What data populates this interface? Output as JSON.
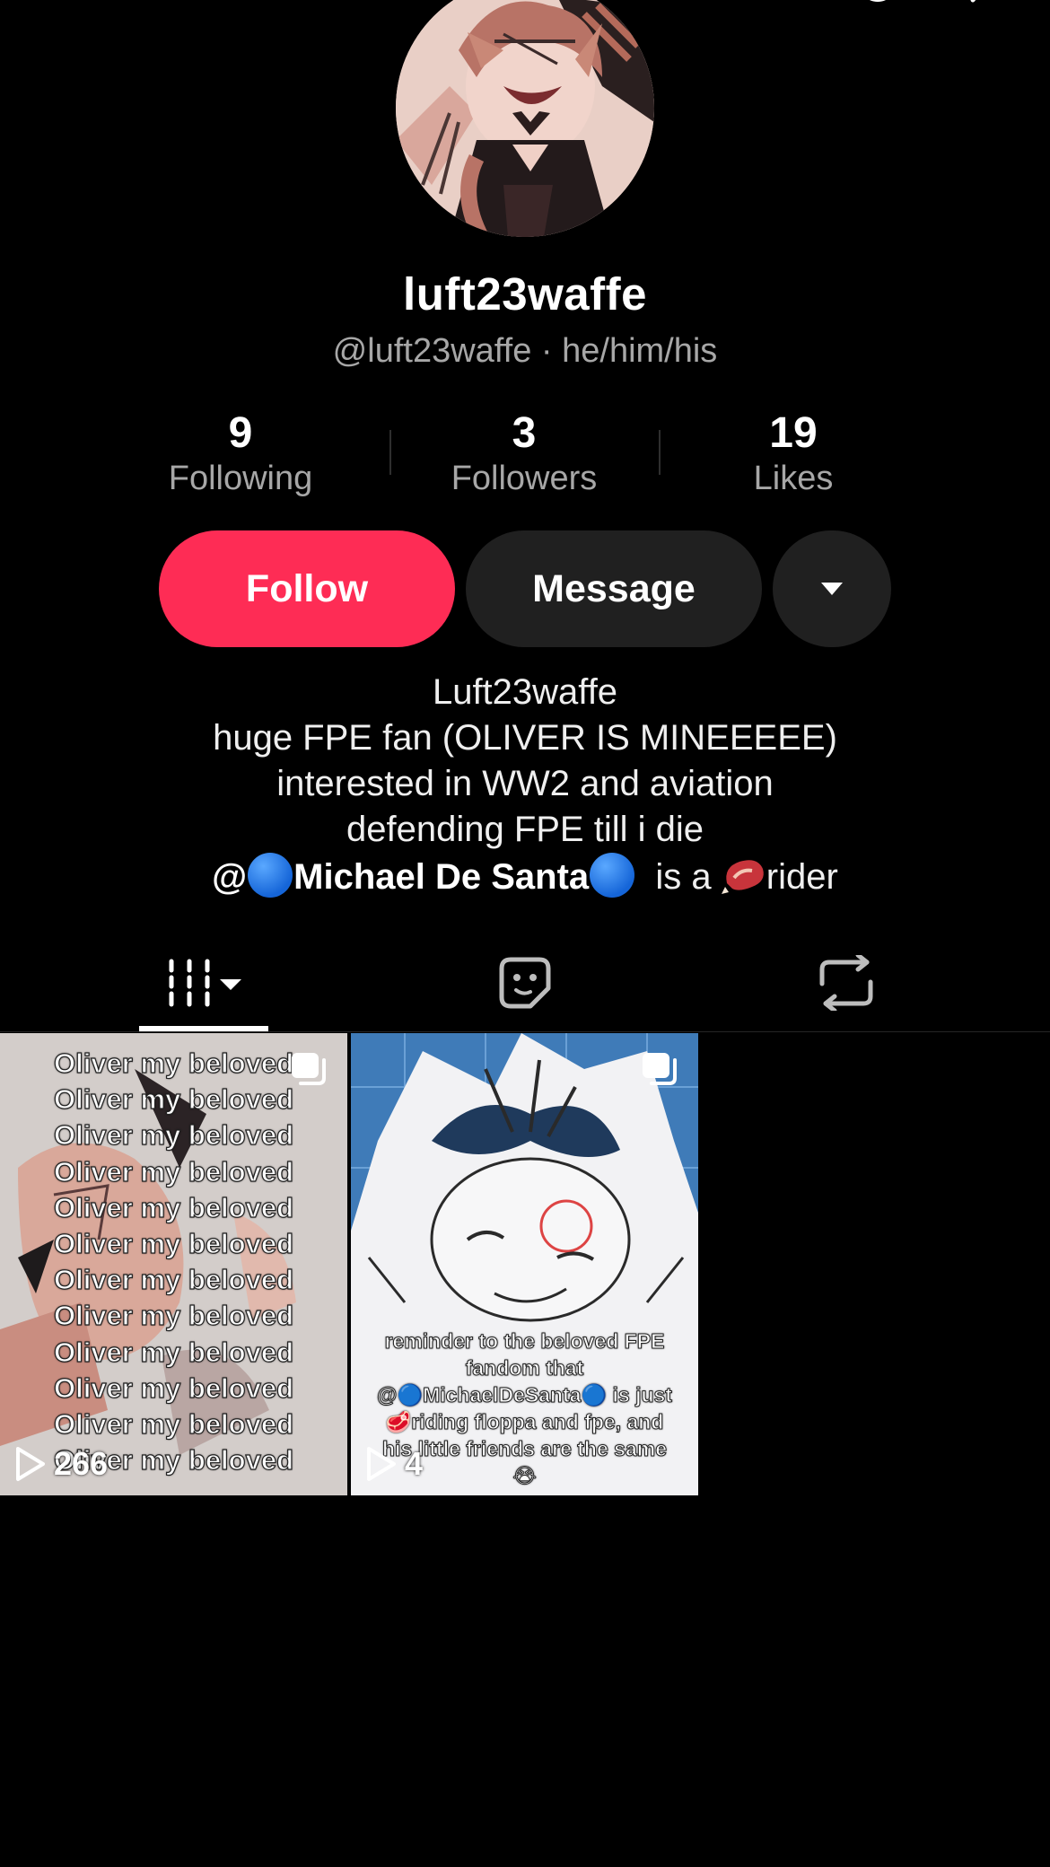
{
  "profile": {
    "display_name": "luft23waffe",
    "handle_line": "@luft23waffe · he/him/his"
  },
  "stats": [
    {
      "value": "9",
      "label": "Following"
    },
    {
      "value": "3",
      "label": "Followers"
    },
    {
      "value": "19",
      "label": "Likes"
    }
  ],
  "actions": {
    "follow_label": "Follow",
    "message_label": "Message"
  },
  "bio": {
    "line1": "Luft23waffe",
    "line2": "huge FPE fan (OLIVER IS MINEEEEE)",
    "line3": "interested in WW2 and aviation",
    "line4": "defending FPE till i die",
    "mention_prefix": "@",
    "mention_name": "Michael De Santa",
    "after_mention": "is a",
    "after_emoji": "rider"
  },
  "tabs": [
    {
      "name": "videos",
      "icon": "grid-icon",
      "active": true
    },
    {
      "name": "favorites",
      "icon": "sticker-icon",
      "active": false
    },
    {
      "name": "reposts",
      "icon": "repost-icon",
      "active": false
    }
  ],
  "videos": [
    {
      "caption_lines": [
        "Oliver my beloved",
        "Oliver my beloved",
        "Oliver my beloved",
        "Oliver my beloved",
        "Oliver my beloved",
        "Oliver my beloved",
        "Oliver my beloved",
        "Oliver my beloved",
        "Oliver my beloved",
        "Oliver my beloved",
        "Oliver my beloved",
        "Oliver my beloved"
      ],
      "views": "266"
    },
    {
      "caption": "reminder to the beloved FPE fandom that @🔵MichaelDeSanta🔵 is just 🥩riding floppa and fpe, and his little friends are the same 😭",
      "views": "4"
    }
  ],
  "colors": {
    "follow": "#fe2c55",
    "button_dark": "#202020",
    "muted_text": "#a7a7a7"
  }
}
